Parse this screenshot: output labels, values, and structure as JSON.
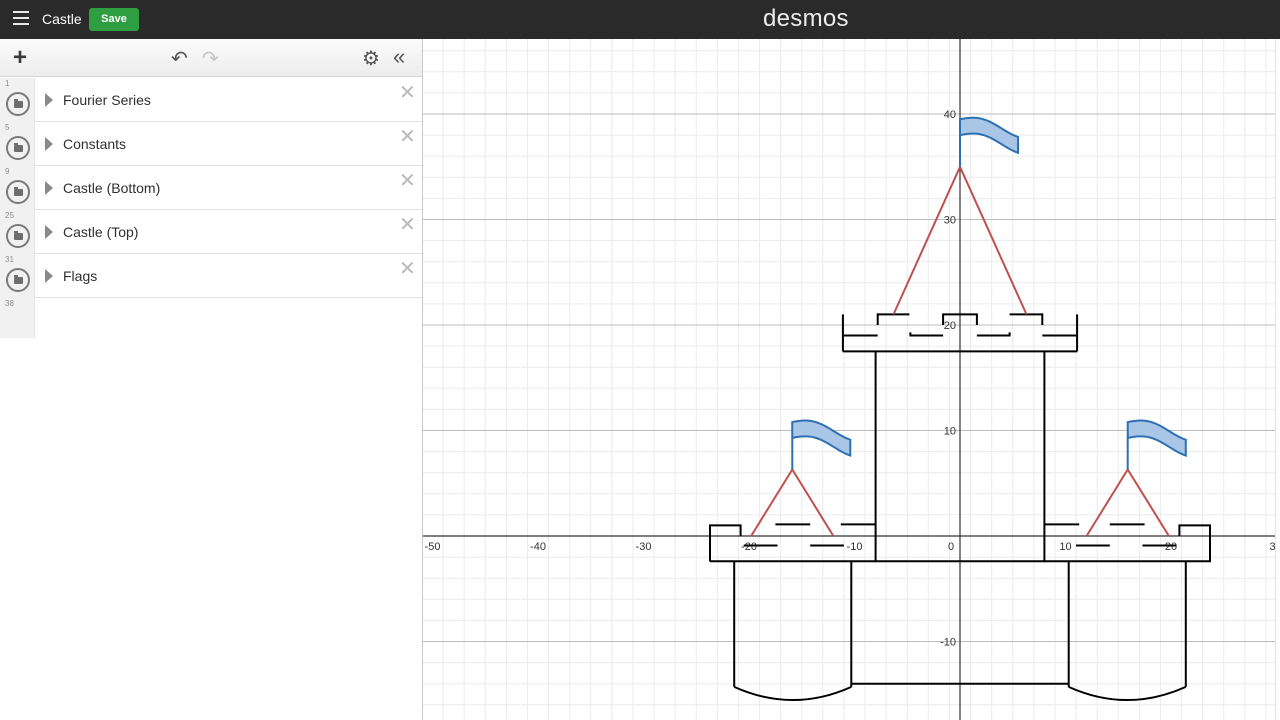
{
  "app": {
    "title": "Castle",
    "save_label": "Save",
    "brand": "desmos"
  },
  "expressions": [
    {
      "num": "1",
      "label": "Fourier Series"
    },
    {
      "num": "5",
      "label": "Constants"
    },
    {
      "num": "9",
      "label": "Castle (Bottom)"
    },
    {
      "num": "25",
      "label": "Castle (Top)"
    },
    {
      "num": "31",
      "label": "Flags"
    }
  ],
  "empty_row_num": "38",
  "toolbar": {
    "add_icon": "plus-icon",
    "undo_icon": "undo-icon",
    "redo_icon": "redo-icon",
    "settings_icon": "gear-icon",
    "collapse_icon": "double-chevron-left-icon"
  },
  "graph": {
    "x_ticks": [
      "-50",
      "-40",
      "-30",
      "-20",
      "-10",
      "0",
      "10",
      "20",
      "3"
    ],
    "y_ticks": [
      "40",
      "30",
      "20",
      "10",
      "-10"
    ],
    "colors": {
      "castle": "#000000",
      "roof": "#c0504d",
      "flag_stroke": "#2d70b3",
      "flag_fill": "#a9c6e6"
    }
  }
}
